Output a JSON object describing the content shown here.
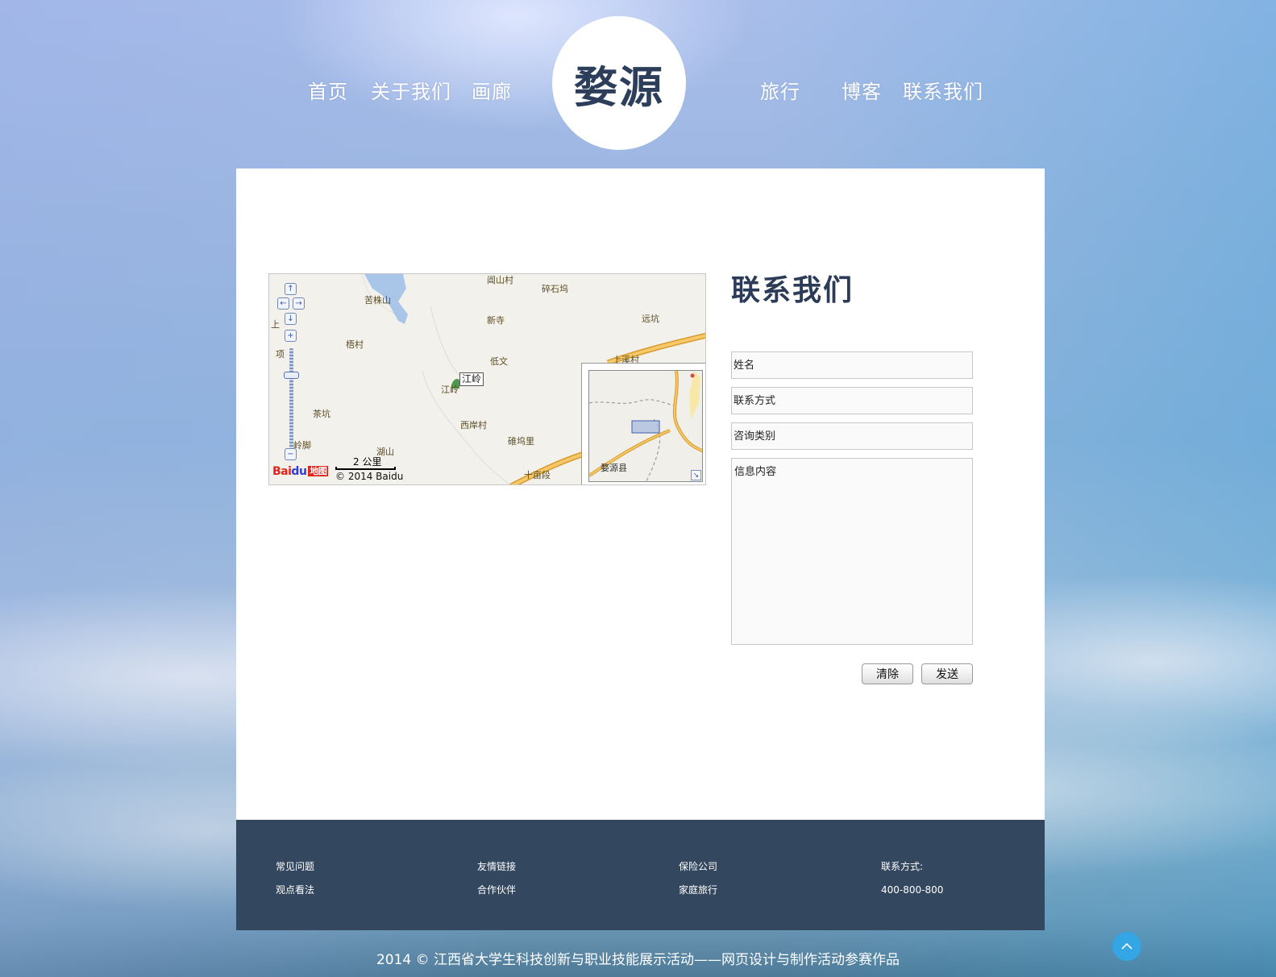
{
  "header": {
    "logo_text": "婺源",
    "nav_left": [
      "首页",
      "关于我们",
      "画廊"
    ],
    "nav_right": [
      "旅行",
      "博客",
      "联系我们"
    ]
  },
  "map": {
    "places": [
      "阊山村",
      "碎石坞",
      "苦株山",
      "新寺",
      "远坑",
      "梧村",
      "项",
      "低文",
      "上溪村",
      "江岭",
      "茶坑",
      "西岸村",
      "碓坞里",
      "湖山",
      "岭脚",
      "十亩段",
      "上"
    ],
    "marker_label": "江岭",
    "scale_label": "2 公里",
    "copyright": "© 2014 Baidu",
    "logo_text": "Bai",
    "logo_paw": "du",
    "logo_suffix": "地图",
    "overview_place": "婺源县",
    "controls": {
      "pan_up": "↑",
      "pan_left": "←",
      "pan_right": "→",
      "pan_down": "↓",
      "zoom_in": "+",
      "zoom_out": "−",
      "overview_toggle": "↘"
    }
  },
  "contact": {
    "title": "联系我们",
    "name_placeholder": "姓名",
    "phone_placeholder": "联系方式",
    "category_placeholder": "咨询类别",
    "message_placeholder": "信息内容",
    "clear_label": "清除",
    "send_label": "发送"
  },
  "footer": {
    "col1": [
      "常见问题",
      "观点看法"
    ],
    "col2": [
      "友情链接",
      "合作伙伴"
    ],
    "col3": [
      "保险公司",
      "家庭旅行"
    ],
    "contact_label": "联系方式:",
    "contact_phone": "400-800-800",
    "copyright": "2014 © 江西省大学生科技创新与职业技能展示活动——网页设计与制作活动参赛作品"
  },
  "colors": {
    "footer_bg": "#33475f",
    "title_color": "#2c3c58",
    "back_to_top": "#33a6e3"
  },
  "icons": {
    "back_to_top": "chevron-up-icon"
  }
}
